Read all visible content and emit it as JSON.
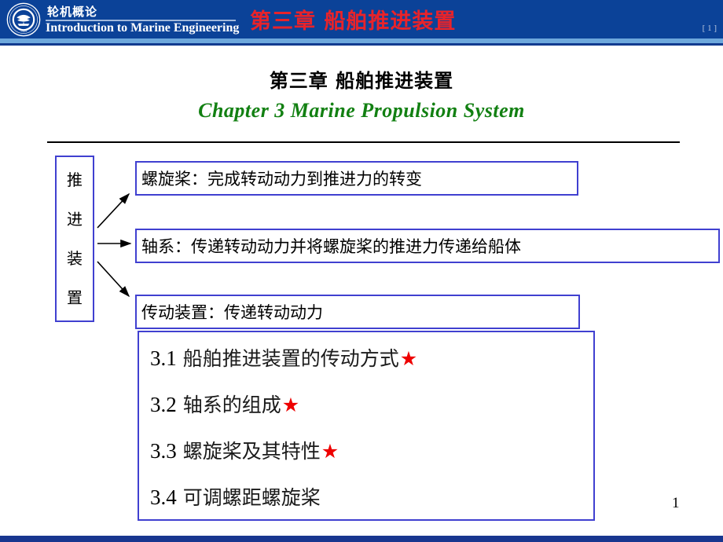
{
  "header": {
    "brand_cn": "轮机概论",
    "brand_en": "Introduction to Marine Engineering",
    "title": "第三章  船舶推进装置",
    "index_marker": "[ 1 ]",
    "logo_icon": "university-seal-icon",
    "bg_color": "#0b4298",
    "title_color": "#e8232a"
  },
  "title": {
    "chinese": "第三章  船舶推进装置",
    "english": "Chapter 3    Marine Propulsion System",
    "english_color": "#128012"
  },
  "diagram": {
    "root_label_chars": [
      "推",
      "进",
      "装",
      "置"
    ],
    "root_label": "推进装置",
    "branches": [
      {
        "text": "螺旋桨：完成转动动力到推进力的转变",
        "arrow": "arrow-up-right"
      },
      {
        "text": "轴系：传递转动动力并将螺旋桨的推进力传递给船体",
        "arrow": "arrow-right"
      },
      {
        "text": "传动装置：传递转动动力",
        "arrow": "arrow-down-right"
      }
    ],
    "border_color": "#4040d0"
  },
  "agenda": {
    "items": [
      {
        "number": "3.1",
        "label": "船舶推进装置的传动方式",
        "starred": true
      },
      {
        "number": "3.2",
        "label": "轴系的组成",
        "starred": true
      },
      {
        "number": "3.3",
        "label": "螺旋桨及其特性",
        "starred": true
      },
      {
        "number": "3.4",
        "label": "可调螺距螺旋桨",
        "starred": false
      }
    ],
    "star_glyph": "★",
    "star_color": "#ee0000"
  },
  "footer": {
    "page_number": "1",
    "bar_color": "#18368f"
  }
}
